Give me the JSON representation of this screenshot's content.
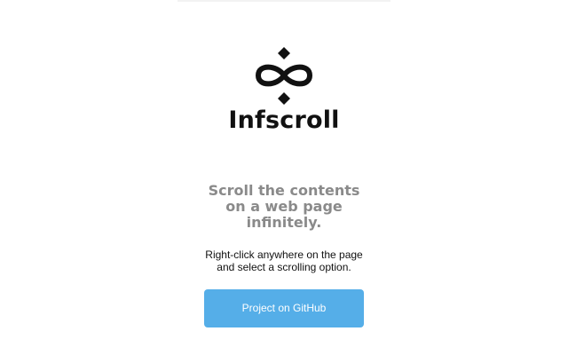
{
  "app": {
    "title": "Infscroll",
    "logo_icon": "infinity-diamond-icon"
  },
  "tagline": {
    "line1": "Scroll the contents",
    "line2": "on a web page",
    "line3": "infinitely."
  },
  "instructions": {
    "line1": "Right-click anywhere on the page",
    "line2": "and select a scrolling option."
  },
  "actions": {
    "github_label": "Project on GitHub"
  },
  "colors": {
    "button_background": "#55aee8",
    "tagline_text": "#8a8a8a",
    "title_text": "#111111"
  }
}
